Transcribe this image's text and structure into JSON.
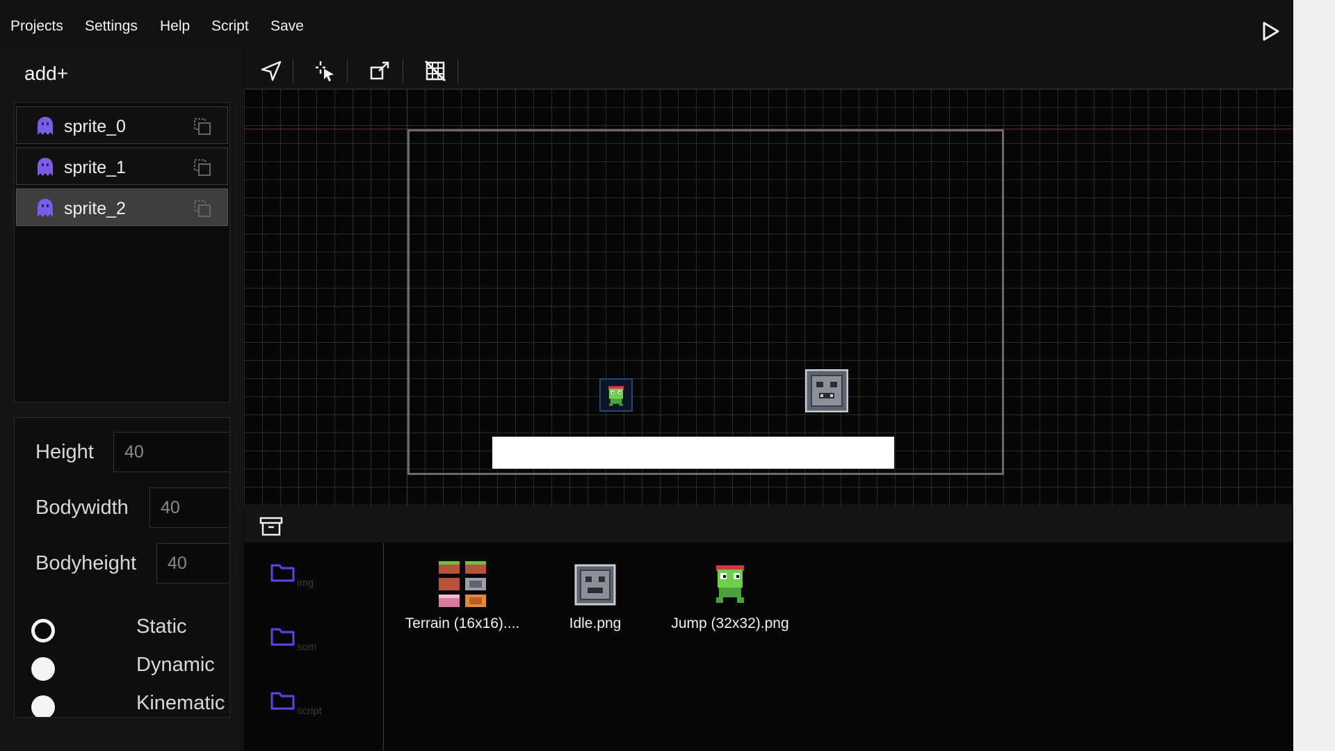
{
  "menu": {
    "items": [
      "Projects",
      "Settings",
      "Help",
      "Script",
      "Save"
    ]
  },
  "sidebar": {
    "add_label": "add+",
    "sprites": [
      {
        "label": "sprite_0",
        "selected": false
      },
      {
        "label": "sprite_1",
        "selected": false
      },
      {
        "label": "sprite_2",
        "selected": true
      }
    ]
  },
  "properties": {
    "height": {
      "label": "Height",
      "value": "40"
    },
    "bodywidth": {
      "label": "Bodywidth",
      "value": "40"
    },
    "bodyheight": {
      "label": "Bodyheight",
      "value": "40"
    },
    "body_types": [
      {
        "label": "Static",
        "checked": true
      },
      {
        "label": "Dynamic",
        "checked": false
      },
      {
        "label": "Kinematic",
        "checked": false
      }
    ]
  },
  "toolbar": {
    "tools": [
      "navigate-icon",
      "select-cursor-icon",
      "scale-icon",
      "grid-toggle-icon"
    ]
  },
  "assets": {
    "folders": [
      {
        "label": "img"
      },
      {
        "label": "som"
      },
      {
        "label": "script"
      }
    ],
    "files": [
      {
        "name": "Terrain (16x16)....",
        "icon": "terrain-tileset-thumbnail"
      },
      {
        "name": "Idle.png",
        "icon": "stone-block-thumbnail"
      },
      {
        "name": "Jump (32x32).png",
        "icon": "frog-thumbnail"
      }
    ]
  },
  "colors": {
    "accent": "#5b45e8",
    "sprite_icon": "#7b5ce6",
    "background": "#0b0b0b"
  }
}
